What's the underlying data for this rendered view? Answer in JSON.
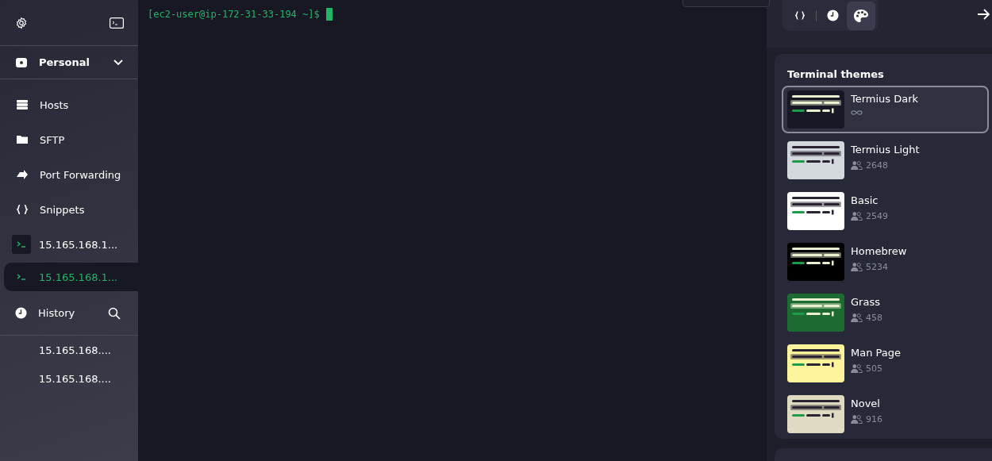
{
  "sidebar": {
    "workspace": {
      "label": "Personal"
    },
    "nav": [
      {
        "label": "Hosts",
        "kind": "hosts"
      },
      {
        "label": "SFTP",
        "kind": "sftp"
      },
      {
        "label": "Port Forwarding",
        "kind": "forward"
      },
      {
        "label": "Snippets",
        "kind": "snippets"
      }
    ],
    "sessions": [
      {
        "label": "15.165.168.1...",
        "selected": false
      },
      {
        "label": "15.165.168.1...",
        "selected": true
      }
    ],
    "history": {
      "label": "History",
      "items": [
        "15.165.168....",
        "15.165.168...."
      ]
    }
  },
  "terminal": {
    "prompt": "[ec2-user@ip-172-31-33-194 ~]$"
  },
  "panel": {
    "tabs": [
      {
        "kind": "snippets",
        "selected": false
      },
      {
        "kind": "history",
        "selected": false
      },
      {
        "kind": "themes",
        "selected": true
      }
    ],
    "title": "Terminal themes",
    "themes": [
      {
        "name": "Termius Dark",
        "kind": "builtin",
        "selected": true,
        "color": "#161925"
      },
      {
        "name": "Termius Light",
        "kind": "shared",
        "users": "2648",
        "selected": false,
        "color": "#d3d8dc"
      },
      {
        "name": "Basic",
        "kind": "shared",
        "users": "2549",
        "selected": false,
        "color": "#ffffff"
      },
      {
        "name": "Homebrew",
        "kind": "shared",
        "users": "5234",
        "selected": false,
        "color": "#000000"
      },
      {
        "name": "Grass",
        "kind": "shared",
        "users": "458",
        "selected": false,
        "color": "#1d6b32"
      },
      {
        "name": "Man Page",
        "kind": "shared",
        "users": "505",
        "selected": false,
        "color": "#fef49c"
      },
      {
        "name": "Novel",
        "kind": "shared",
        "users": "916",
        "selected": false,
        "color": "#dfdbc3"
      }
    ]
  }
}
